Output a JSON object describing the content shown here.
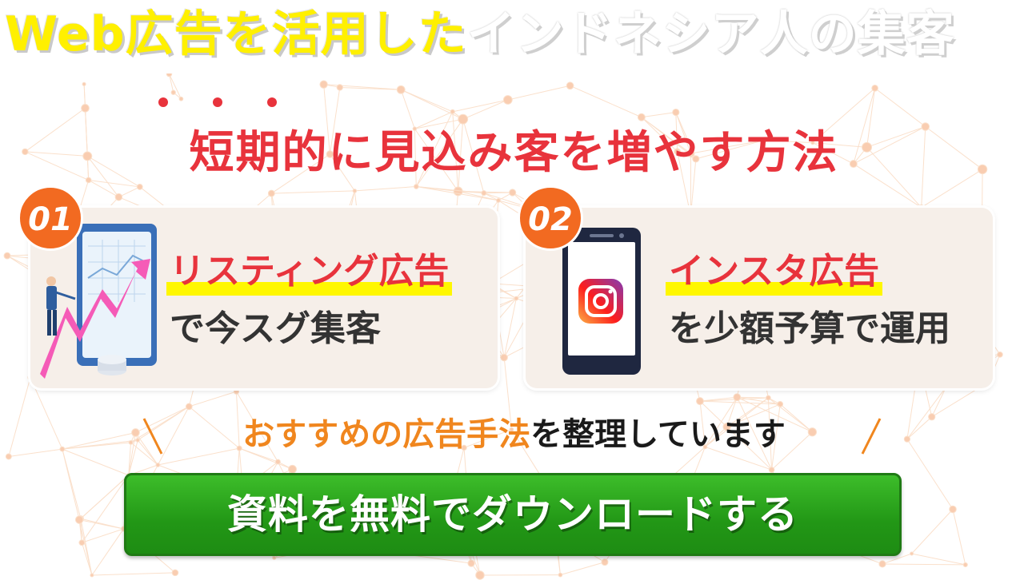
{
  "headline": {
    "yellow_part": "Web広告を活用した",
    "white_part": "インドネシア人の集客"
  },
  "subtitle": "短期的に見込み客を増やす方法",
  "cards": [
    {
      "number": "01",
      "title": "リスティング広告",
      "desc": "で今スグ集客",
      "icon": "growth-chart-illustration"
    },
    {
      "number": "02",
      "title": "インスタ広告",
      "desc": "を少額予算で運用",
      "icon": "instagram-phone-icon"
    }
  ],
  "recommend": {
    "orange_part": "おすすめの広告手法",
    "black_part": "を整理しています"
  },
  "cta": {
    "label": "資料を無料でダウンロードする"
  },
  "colors": {
    "accent_red": "#e8333c",
    "badge_orange": "#f26a21",
    "highlight_yellow": "#fff700",
    "cta_green": "#229716"
  }
}
